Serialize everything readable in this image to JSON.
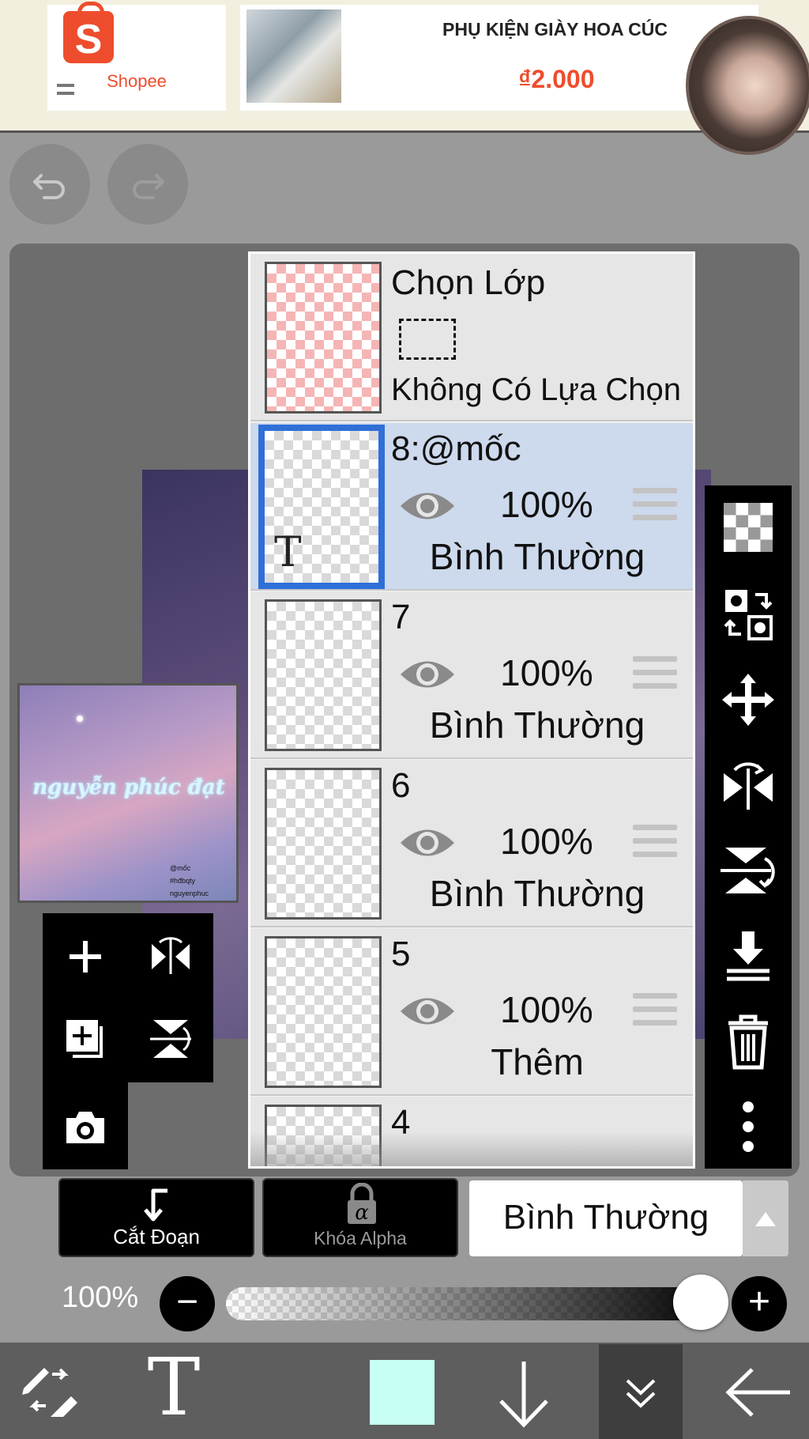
{
  "ad": {
    "brand": "Shopee",
    "brand_letter": "S",
    "product_title": "PHỤ KIỆN GIÀY HOA CÚC",
    "product_price": "₫2.000"
  },
  "preview": {
    "title_text": "nguyễn phúc đạt",
    "small_lines": [
      "@mốc",
      "#hđbqty",
      "nguyenphuc"
    ]
  },
  "layer_panel": {
    "selection_layer": {
      "title": "Chọn Lớp",
      "subtitle": "Không Có Lựa Chọn"
    },
    "layers": [
      {
        "name": "8:@mốc",
        "opacity": "100%",
        "blend": "Bình Thường",
        "selected": true,
        "thumb_text": "T"
      },
      {
        "name": "7",
        "opacity": "100%",
        "blend": "Bình Thường",
        "selected": false
      },
      {
        "name": "6",
        "opacity": "100%",
        "blend": "Bình Thường",
        "selected": false
      },
      {
        "name": "5",
        "opacity": "100%",
        "blend": "Thêm",
        "selected": false
      },
      {
        "name": "4",
        "opacity": "",
        "blend": "",
        "selected": false
      }
    ]
  },
  "bottom_controls": {
    "clip_label": "Cắt Đoạn",
    "alpha_lock_label": "Khóa Alpha",
    "blend_mode": "Bình Thường",
    "opacity_label": "100%",
    "opacity_value": 1.0,
    "minus": "−",
    "plus": "+"
  },
  "toolbar": {
    "text_tool": "T",
    "current_color": "#c8fff4"
  },
  "colors": {
    "selected_layer_bg": "#cdd9ec",
    "selection_border": "#2f6fd8",
    "shopee_orange": "#ee4d2d"
  }
}
